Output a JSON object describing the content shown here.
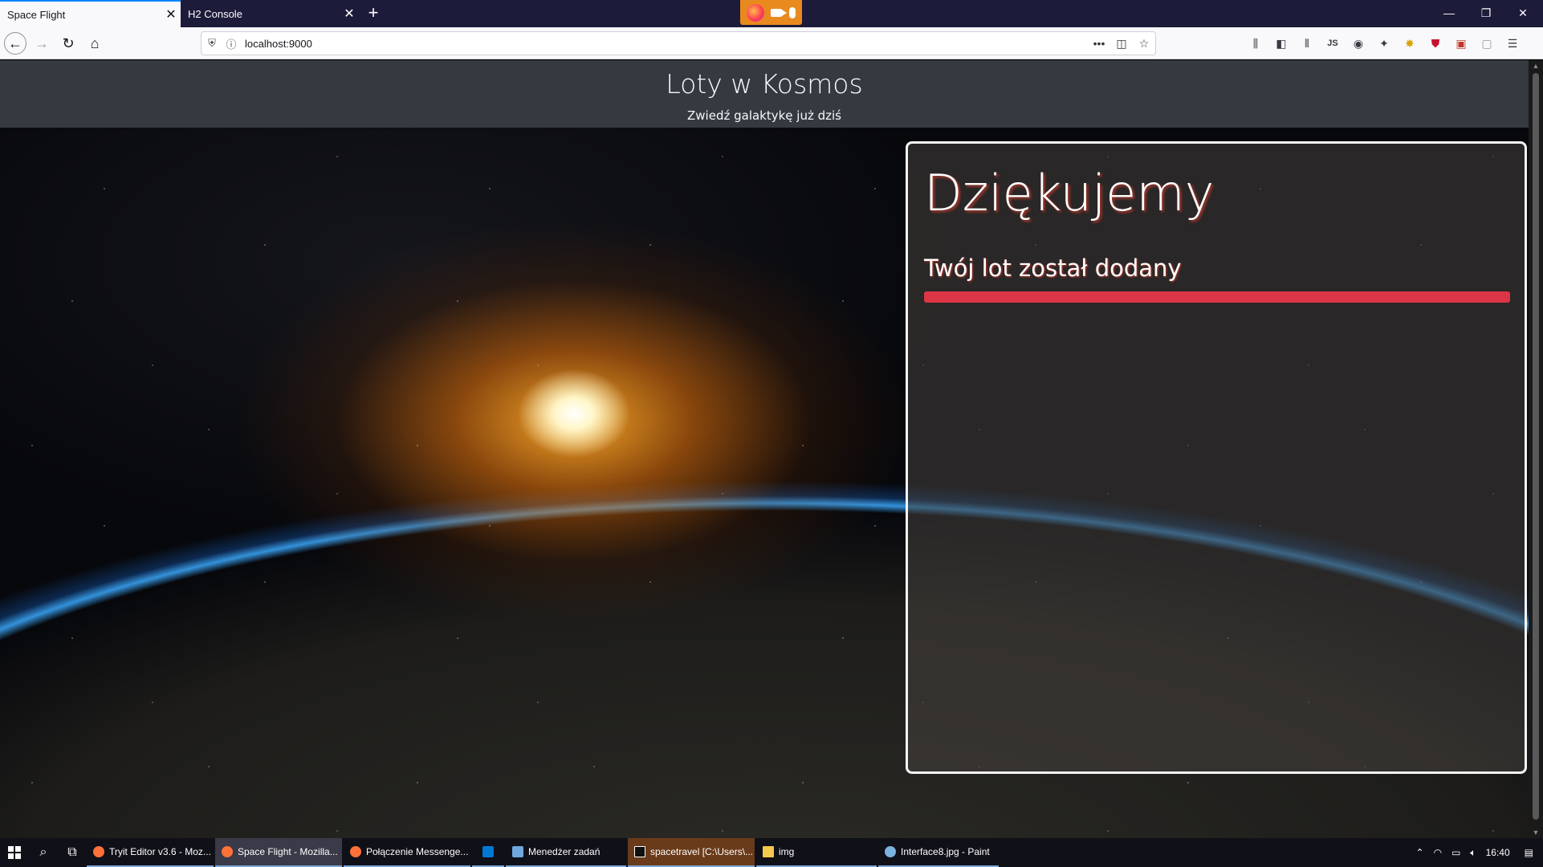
{
  "browser": {
    "tabs": [
      {
        "label": "Space Flight",
        "active": true
      },
      {
        "label": "H2 Console",
        "active": false
      }
    ],
    "url": "localhost:9000",
    "accent_color": "#0a84ff"
  },
  "page": {
    "header": {
      "title": "Loty w Kosmos",
      "subtitle": "Zwiedź galaktykę już dziś"
    },
    "panel": {
      "title": "Dziękujemy",
      "message": "Twój lot został dodany",
      "progress_percent": 100,
      "progress_color": "#dc3545"
    }
  },
  "taskbar": {
    "apps": [
      {
        "label": "Tryit Editor v3.6 - Moz...",
        "icon": "firefox-icon"
      },
      {
        "label": "Space Flight - Mozilla...",
        "icon": "firefox-icon",
        "active": true
      },
      {
        "label": "Połączenie Messenge...",
        "icon": "firefox-icon"
      },
      {
        "label": "",
        "icon": "vscode-icon"
      },
      {
        "label": "Menedżer zadań",
        "icon": "task-manager-icon"
      },
      {
        "label": "spacetravel [C:\\Users\\...",
        "icon": "intellij-icon"
      },
      {
        "label": "img",
        "icon": "folder-icon"
      },
      {
        "label": "Interface8.jpg - Paint",
        "icon": "paint-icon"
      }
    ],
    "clock": "16:40"
  }
}
